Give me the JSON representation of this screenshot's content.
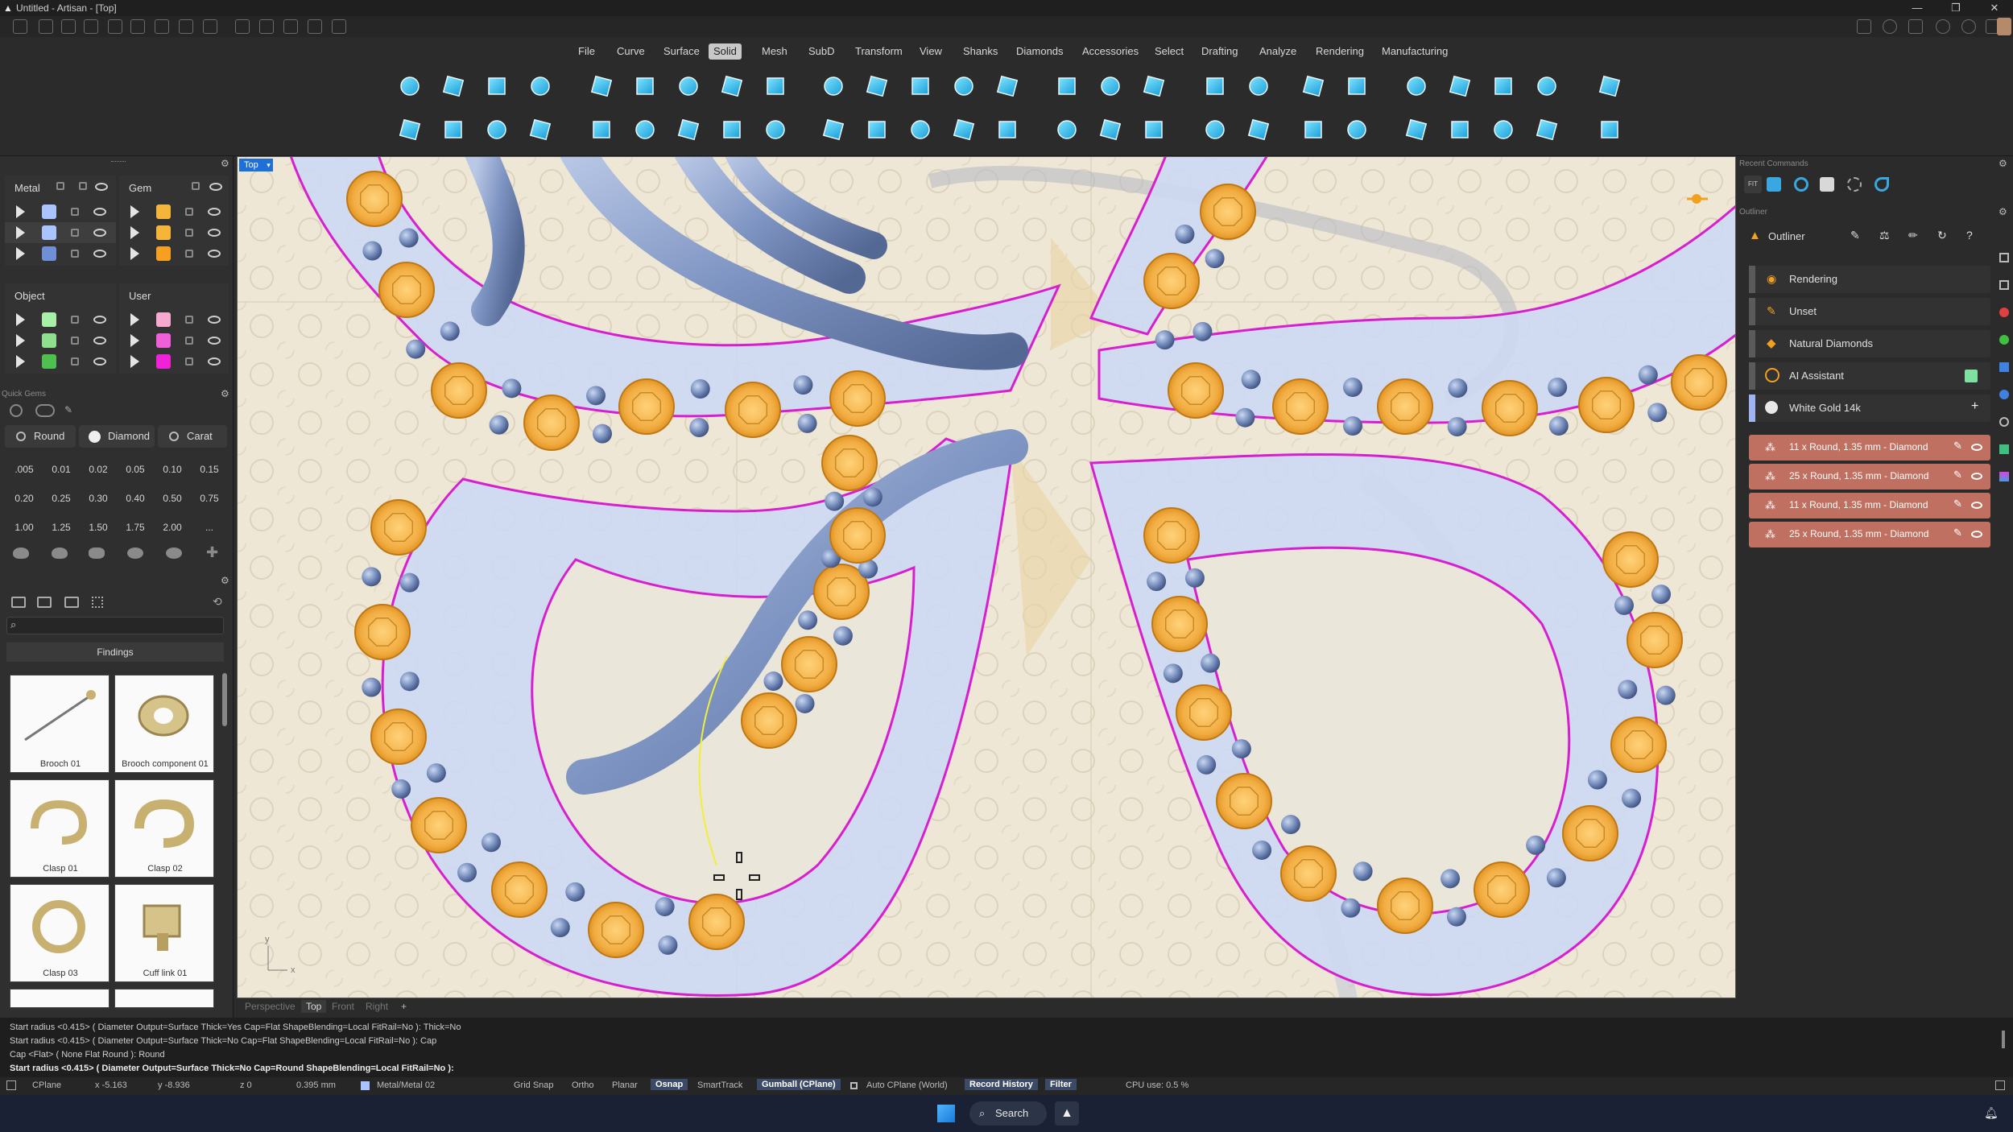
{
  "window": {
    "title": "Untitled - Artisan - [Top]"
  },
  "menu": [
    "File",
    "Curve",
    "Surface",
    "Solid",
    "Mesh",
    "SubD",
    "Transform",
    "View",
    "Shanks",
    "Diamonds",
    "Accessories",
    "Select",
    "Drafting",
    "Analyze",
    "Rendering",
    "Manufacturing"
  ],
  "menu_active": "Solid",
  "layers": {
    "metal": {
      "title": "Metal",
      "swatches": [
        "#a9c4ff",
        "#a9c4ff",
        "#6f8fd6"
      ]
    },
    "gem": {
      "title": "Gem",
      "swatches": [
        "#f5b43a",
        "#f5b43a",
        "#f5a020"
      ]
    },
    "object": {
      "title": "Object",
      "swatches": [
        "#a8f0a8",
        "#8ee08e",
        "#4fc04f"
      ]
    },
    "user": {
      "title": "User",
      "swatches": [
        "#f7a9cf",
        "#ef5fd8",
        "#ef22d8"
      ]
    }
  },
  "quick_gems": {
    "title": "Quick Gems",
    "tabs": [
      "Round",
      "Diamond",
      "Carat"
    ],
    "sizes": [
      ".005",
      "0.01",
      "0.02",
      "0.05",
      "0.10",
      "0.15",
      "0.20",
      "0.25",
      "0.30",
      "0.40",
      "0.50",
      "0.75",
      "1.00",
      "1.25",
      "1.50",
      "1.75",
      "2.00",
      "..."
    ]
  },
  "findings": {
    "title": "Findings",
    "items": [
      "Brooch 01",
      "Brooch component 01",
      "Clasp 01",
      "Clasp 02",
      "Clasp 03",
      "Cuff link 01"
    ]
  },
  "viewport": {
    "label": "Top",
    "tabs": [
      "Perspective",
      "Top",
      "Front",
      "Right",
      "+"
    ],
    "active_tab": "Top",
    "axis_x": "x",
    "axis_y": "y"
  },
  "right_panel": {
    "recent_commands_title": "Recent Commands",
    "outliner_section_title": "Outliner",
    "outliner_header": "Outliner",
    "items": [
      "Rendering",
      "Unset",
      "Natural Diamonds",
      "AI Assistant",
      "White Gold 14k"
    ],
    "gems": [
      "11 x Round, 1.35 mm - Diamond",
      "25 x Round, 1.35 mm - Diamond",
      "11 x Round, 1.35 mm - Diamond",
      "25 x Round, 1.35 mm - Diamond"
    ]
  },
  "command_log": [
    "Start radius <0.415> ( Diameter  Output=Surface  Thick=Yes  Cap=Flat  ShapeBlending=Local  FitRail=No ): Thick=No",
    "Start radius <0.415> ( Diameter  Output=Surface  Thick=No  Cap=Flat  ShapeBlending=Local  FitRail=No ): Cap",
    "Cap <Flat> ( None  Flat  Round ): Round",
    "Start radius <0.415> ( Diameter  Output=Surface  Thick=No  Cap=Round  ShapeBlending=Local  FitRail=No ):"
  ],
  "status": {
    "cplane": "CPlane",
    "x": "x -5.163",
    "y": "y -8.936",
    "z": "z 0",
    "dist": "0.395 mm",
    "layer": "Metal/Metal 02",
    "grid_snap": "Grid Snap",
    "ortho": "Ortho",
    "planar": "Planar",
    "osnap": "Osnap",
    "smarttrack": "SmartTrack",
    "gumball": "Gumball (CPlane)",
    "auto_cplane": "Auto CPlane (World)",
    "record_history": "Record History",
    "filter": "Filter",
    "cpu": "CPU use: 0.5 %"
  },
  "taskbar": {
    "search": "Search"
  }
}
